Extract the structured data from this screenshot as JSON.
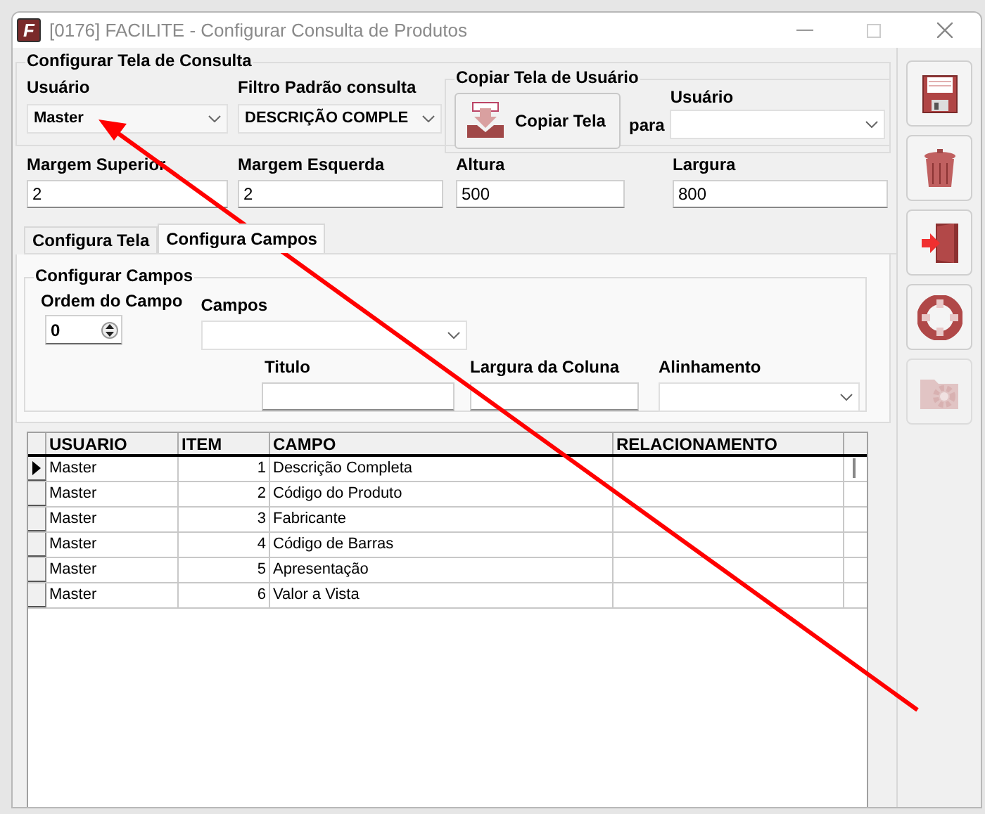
{
  "window": {
    "title": "[0176] FACILITE - Configurar Consulta de Produtos",
    "icon_letter": "F"
  },
  "config_group": {
    "title": "Configurar Tela de Consulta",
    "usuario": {
      "label": "Usuário",
      "value": "Master"
    },
    "filtro": {
      "label": "Filtro Padrão consulta",
      "value": "DESCRIÇÃO COMPLE"
    },
    "copy_group": {
      "title": "Copiar Tela de Usuário",
      "button_label": "Copiar Tela",
      "para_label": "para",
      "usuario_label": "Usuário"
    },
    "fields": [
      {
        "label": "Margem Superior",
        "value": "2"
      },
      {
        "label": "Margem Esquerda",
        "value": "2"
      },
      {
        "label": "Altura",
        "value": "500"
      },
      {
        "label": "Largura",
        "value": "800"
      }
    ]
  },
  "tabs": [
    {
      "label": "Configura Tela",
      "selected": false
    },
    {
      "label": "Configura Campos",
      "selected": true
    }
  ],
  "campos_group": {
    "title": "Configurar Campos",
    "ordem": {
      "label": "Ordem do Campo",
      "value": "0"
    },
    "campos_label": "Campos",
    "titulo_label": "Titulo",
    "largura_label": "Largura da Coluna",
    "alinhamento_label": "Alinhamento"
  },
  "grid": {
    "columns": [
      "USUARIO",
      "ITEM",
      "CAMPO",
      "RELACIONAMENTO"
    ],
    "rows": [
      {
        "usuario": "Master",
        "item": "1",
        "campo": "Descrição Completa",
        "selected": true
      },
      {
        "usuario": "Master",
        "item": "2",
        "campo": "Código do Produto",
        "selected": false
      },
      {
        "usuario": "Master",
        "item": "3",
        "campo": "Fabricante",
        "selected": false
      },
      {
        "usuario": "Master",
        "item": "4",
        "campo": "Código de Barras",
        "selected": false
      },
      {
        "usuario": "Master",
        "item": "5",
        "campo": "Apresentação",
        "selected": false
      },
      {
        "usuario": "Master",
        "item": "6",
        "campo": "Valor a Vista",
        "selected": false
      }
    ]
  },
  "toolbar": [
    {
      "kind": "save",
      "disabled": false
    },
    {
      "kind": "delete",
      "disabled": false
    },
    {
      "kind": "exit",
      "disabled": false
    },
    {
      "kind": "help",
      "disabled": false
    },
    {
      "kind": "settings",
      "disabled": true
    }
  ]
}
